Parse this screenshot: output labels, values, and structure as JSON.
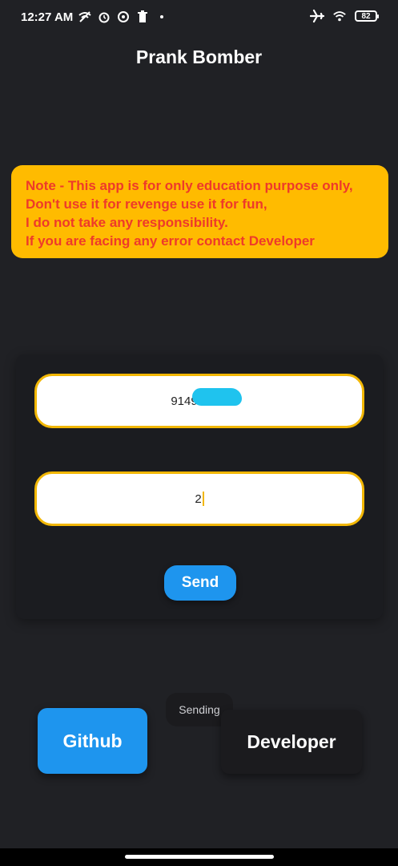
{
  "status_bar": {
    "time": "12:27 AM",
    "icons_left": [
      "muted-wifi-icon",
      "alarm-icon",
      "whatsapp-icon",
      "trash-icon",
      "dot-icon"
    ],
    "icons_right": [
      "airplane-icon",
      "wifi-icon",
      "battery-icon"
    ],
    "battery": "82"
  },
  "app": {
    "title": "Prank Bomber"
  },
  "note": {
    "lines": [
      "Note - This app is for only education purpose only,",
      "Don't use it for revenge use it for fun,",
      "I do not take any responsibility.",
      "If you are facing any error contact Developer"
    ],
    "background": "#ffbb00",
    "text_color": "#ee3a2a"
  },
  "form": {
    "phone_value": "9149",
    "count_value": "2",
    "send_label": "Send"
  },
  "toast": {
    "text": "Sending"
  },
  "buttons": {
    "github_label": "Github",
    "developer_label": "Developer"
  },
  "colors": {
    "background": "#202125",
    "accent_blue": "#1e95ee",
    "field_border": "#f2b705"
  }
}
